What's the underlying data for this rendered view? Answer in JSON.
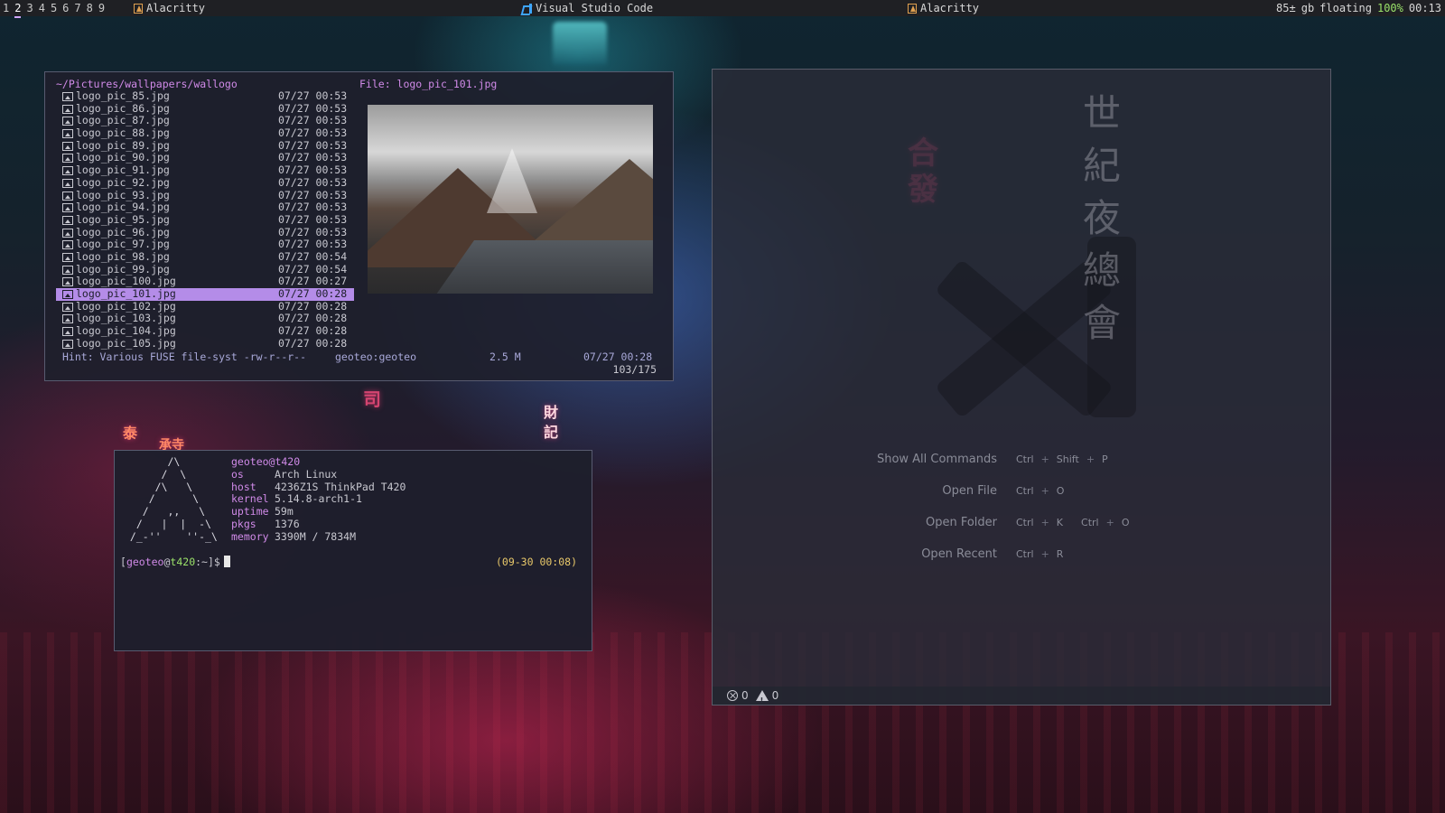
{
  "topbar": {
    "workspaces": [
      "1",
      "2",
      "3",
      "4",
      "5",
      "6",
      "7",
      "8",
      "9"
    ],
    "active_workspace": "2",
    "windows": [
      {
        "title": "Alacritty",
        "icon": "alacritty-icon"
      },
      {
        "title": "Visual Studio Code",
        "icon": "vscode-icon"
      },
      {
        "title": "Alacritty",
        "icon": "alacritty-icon"
      }
    ],
    "status": {
      "disk": "85±",
      "network": "gb",
      "layout": "floating",
      "battery": "100%",
      "time": "00:13"
    }
  },
  "ranger": {
    "path": "~/Pictures/wallpapers/wallogo",
    "file_label": "File: logo_pic_101.jpg",
    "files": [
      {
        "name": "logo_pic_85.jpg",
        "date": "07/27 00:53"
      },
      {
        "name": "logo_pic_86.jpg",
        "date": "07/27 00:53"
      },
      {
        "name": "logo_pic_87.jpg",
        "date": "07/27 00:53"
      },
      {
        "name": "logo_pic_88.jpg",
        "date": "07/27 00:53"
      },
      {
        "name": "logo_pic_89.jpg",
        "date": "07/27 00:53"
      },
      {
        "name": "logo_pic_90.jpg",
        "date": "07/27 00:53"
      },
      {
        "name": "logo_pic_91.jpg",
        "date": "07/27 00:53"
      },
      {
        "name": "logo_pic_92.jpg",
        "date": "07/27 00:53"
      },
      {
        "name": "logo_pic_93.jpg",
        "date": "07/27 00:53"
      },
      {
        "name": "logo_pic_94.jpg",
        "date": "07/27 00:53"
      },
      {
        "name": "logo_pic_95.jpg",
        "date": "07/27 00:53"
      },
      {
        "name": "logo_pic_96.jpg",
        "date": "07/27 00:53"
      },
      {
        "name": "logo_pic_97.jpg",
        "date": "07/27 00:53"
      },
      {
        "name": "logo_pic_98.jpg",
        "date": "07/27 00:54"
      },
      {
        "name": "logo_pic_99.jpg",
        "date": "07/27 00:54"
      },
      {
        "name": "logo_pic_100.jpg",
        "date": "07/27 00:27"
      },
      {
        "name": "logo_pic_101.jpg",
        "date": "07/27 00:28",
        "selected": true
      },
      {
        "name": "logo_pic_102.jpg",
        "date": "07/27 00:28"
      },
      {
        "name": "logo_pic_103.jpg",
        "date": "07/27 00:28"
      },
      {
        "name": "logo_pic_104.jpg",
        "date": "07/27 00:28"
      },
      {
        "name": "logo_pic_105.jpg",
        "date": "07/27 00:28"
      }
    ],
    "hint": "Hint: Various FUSE file-syst -rw-r--r--",
    "owner": "geoteo:geoteo",
    "size": "2.5 M",
    "mtime": "07/27 00:28",
    "position": "103/175"
  },
  "terminal": {
    "ascii_logo": "       /\\\n      /  \\\n     /\\   \\\n    /      \\\n   /   ,,   \\\n  /   |  |  -\\\n /_-''    ''-_\\",
    "user_host": "geoteo@t420",
    "info": [
      {
        "key": "os",
        "value": "Arch Linux"
      },
      {
        "key": "host",
        "value": "4236Z1S ThinkPad T420"
      },
      {
        "key": "kernel",
        "value": "5.14.8-arch1-1"
      },
      {
        "key": "uptime",
        "value": "59m"
      },
      {
        "key": "pkgs",
        "value": "1376"
      },
      {
        "key": "memory",
        "value": "3390M / 7834M"
      }
    ],
    "prompt": {
      "open": "[",
      "user": "geoteo",
      "at": "@",
      "host": "t420",
      "rest": ":~]$"
    },
    "clock": "(09-30 00:08)"
  },
  "vscode": {
    "kanji": [
      "世",
      "紀",
      "夜",
      "總",
      "會"
    ],
    "shortcuts": [
      {
        "label": "Show All Commands",
        "keys": [
          [
            "Ctrl",
            "Shift",
            "P"
          ]
        ]
      },
      {
        "label": "Open File",
        "keys": [
          [
            "Ctrl",
            "O"
          ]
        ]
      },
      {
        "label": "Open Folder",
        "keys": [
          [
            "Ctrl",
            "K"
          ],
          [
            "Ctrl",
            "O"
          ]
        ]
      },
      {
        "label": "Open Recent",
        "keys": [
          [
            "Ctrl",
            "R"
          ]
        ]
      }
    ],
    "status": {
      "errors": "0",
      "warnings": "0"
    }
  },
  "wallpaper": {
    "neon_signs": [
      {
        "text": "合發",
        "color": "#ff5082"
      },
      {
        "text": "司",
        "color": "#ff5082"
      },
      {
        "text": "財記",
        "color": "#ff5082"
      },
      {
        "text": "泰",
        "color": "#ff5082"
      },
      {
        "text": "承寺",
        "color": "#ff5082"
      }
    ]
  },
  "colors": {
    "accent": "#d08ae8",
    "selection": "#b48ce8",
    "battery": "#9be36a",
    "clock": "#e8c86a",
    "window_bg": "#1e1f2c"
  }
}
